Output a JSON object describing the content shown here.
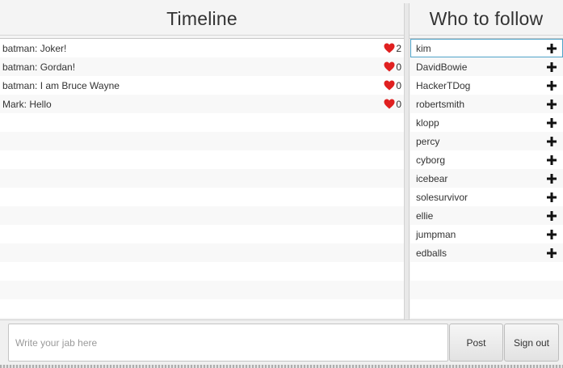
{
  "timeline": {
    "title": "Timeline",
    "rows_total": 15,
    "posts": [
      {
        "text": "batman: Joker!",
        "likes": "2"
      },
      {
        "text": "batman: Gordan!",
        "likes": "0"
      },
      {
        "text": "batman: I am Bruce Wayne",
        "likes": "0"
      },
      {
        "text": "Mark: Hello",
        "likes": "0"
      }
    ]
  },
  "follow": {
    "title": "Who to follow",
    "rows_total": 15,
    "selected_index": 0,
    "users": [
      "kim",
      "DavidBowie",
      "HackerTDog",
      "robertsmith",
      "klopp",
      "percy",
      "cyborg",
      "icebear",
      "solesurvivor",
      "ellie",
      "jumpman",
      "edballs"
    ]
  },
  "compose": {
    "placeholder": "Write your jab here",
    "post_label": "Post",
    "signout_label": "Sign out"
  },
  "colors": {
    "heart": "#e02020",
    "selection": "#4fa3c8"
  },
  "icons": {
    "like": "heart-icon",
    "follow": "plus-icon"
  }
}
